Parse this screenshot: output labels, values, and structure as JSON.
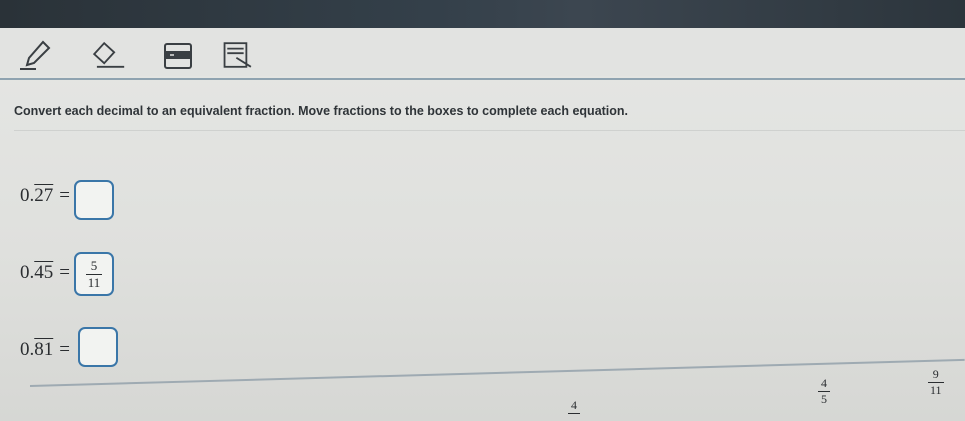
{
  "toolbar": {
    "tools": [
      {
        "name": "pencil-icon"
      },
      {
        "name": "eraser-icon"
      },
      {
        "name": "answer-masking-icon"
      },
      {
        "name": "line-reader-icon"
      }
    ]
  },
  "instruction": "Convert each decimal to an equivalent fraction. Move fractions to the boxes to complete each equation.",
  "equations": [
    {
      "prefix": "0.",
      "repeat": "27",
      "equals": "=",
      "answer": null
    },
    {
      "prefix": "0.",
      "repeat": "45",
      "equals": "=",
      "answer": {
        "num": "5",
        "den": "11"
      }
    },
    {
      "prefix": "0.",
      "repeat": "81",
      "equals": "=",
      "answer": null
    }
  ],
  "tiles": [
    {
      "num": "4",
      "den": ""
    },
    {
      "num": "4",
      "den": "5"
    },
    {
      "num": "9",
      "den": "11"
    }
  ],
  "colors": {
    "accent": "#3a76a8",
    "text": "#2a2d30",
    "topbar": "#2f3940"
  }
}
